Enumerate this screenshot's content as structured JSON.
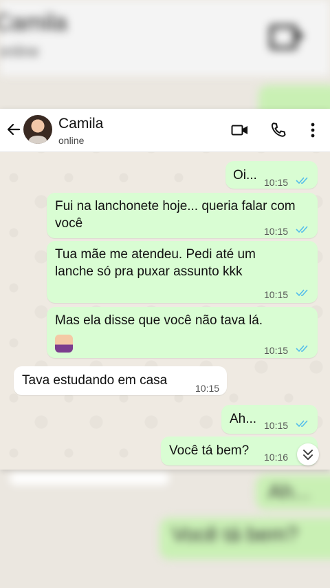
{
  "background": {
    "title": "Camila",
    "status": "online",
    "bubble_1": "Ah...",
    "bubble_2": "Você tá bem?"
  },
  "header": {
    "contact_name": "Camila",
    "status": "online",
    "icons": [
      "arrow-left-icon",
      "video-camera-icon",
      "phone-icon",
      "more-vertical-icon"
    ]
  },
  "messages": [
    {
      "direction": "out",
      "text": "Oi...",
      "time": "10:15",
      "read": true
    },
    {
      "direction": "out",
      "text": "Fui na lanchonete hoje... queria falar com você",
      "time": "10:15",
      "read": true
    },
    {
      "direction": "out",
      "text": "Tua mãe me atendeu. Pedi até um lanche só pra puxar assunto kkk",
      "time": "10:15",
      "read": true
    },
    {
      "direction": "out",
      "text": "Mas ela disse que você não tava lá.",
      "emoji": "facepalm-emoji",
      "time": "10:15",
      "read": true
    },
    {
      "direction": "in",
      "text": "Tava estudando em casa",
      "time": "10:15"
    },
    {
      "direction": "out",
      "text": "Ah...",
      "time": "10:15",
      "read": true
    },
    {
      "direction": "out",
      "text": "Você tá bem?",
      "time": "10:16",
      "read": false
    }
  ],
  "colors": {
    "outgoing_bubble": "#d9fdd3",
    "incoming_bubble": "#ffffff",
    "read_tick": "#53bdeb",
    "header_bg": "#ffffff"
  }
}
